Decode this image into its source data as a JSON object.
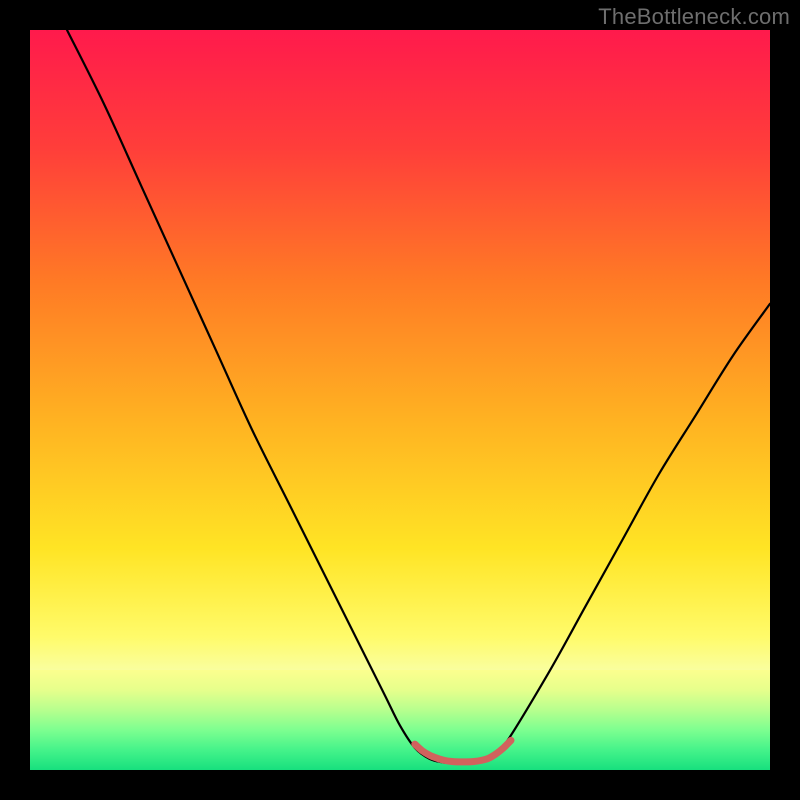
{
  "watermark": "TheBottleneck.com",
  "colors": {
    "frame": "#000000",
    "gradient_stops": [
      {
        "offset": 0.0,
        "color": "#ff1a4c"
      },
      {
        "offset": 0.16,
        "color": "#ff3e3a"
      },
      {
        "offset": 0.34,
        "color": "#ff7a25"
      },
      {
        "offset": 0.52,
        "color": "#ffb022"
      },
      {
        "offset": 0.7,
        "color": "#ffe424"
      },
      {
        "offset": 0.82,
        "color": "#fffb6a"
      },
      {
        "offset": 0.88,
        "color": "#f7ffb0"
      },
      {
        "offset": 0.92,
        "color": "#d0ff9e"
      },
      {
        "offset": 0.95,
        "color": "#8fff95"
      },
      {
        "offset": 0.975,
        "color": "#4cf58b"
      },
      {
        "offset": 1.0,
        "color": "#17e07e"
      }
    ],
    "bottom_strip_stops": [
      {
        "offset": 0.0,
        "color": "#fcff8e"
      },
      {
        "offset": 0.2,
        "color": "#e6ff8c"
      },
      {
        "offset": 0.4,
        "color": "#b7ff8e"
      },
      {
        "offset": 0.6,
        "color": "#7dff90"
      },
      {
        "offset": 0.8,
        "color": "#45f38a"
      },
      {
        "offset": 1.0,
        "color": "#17e07e"
      }
    ],
    "curve": "#000000",
    "highlight": "#d1625d"
  },
  "chart_data": {
    "type": "line",
    "title": "",
    "xlabel": "",
    "ylabel": "",
    "xlim": [
      0,
      100
    ],
    "ylim": [
      0,
      100
    ],
    "series": [
      {
        "name": "bottleneck-curve",
        "x": [
          5,
          10,
          15,
          20,
          25,
          30,
          35,
          40,
          45,
          48,
          50,
          52,
          54,
          56,
          58,
          60,
          62,
          64,
          70,
          75,
          80,
          85,
          90,
          95,
          100
        ],
        "y": [
          100,
          90,
          79,
          68,
          57,
          46,
          36,
          26,
          16,
          10,
          6,
          3,
          1.5,
          1,
          1,
          1.2,
          1.8,
          3.2,
          13,
          22,
          31,
          40,
          48,
          56,
          63
        ]
      },
      {
        "name": "optimal-range-highlight",
        "x": [
          52,
          53,
          54,
          55,
          56,
          57,
          58,
          59,
          60,
          61,
          62,
          63,
          64,
          65
        ],
        "y": [
          3.5,
          2.6,
          2.0,
          1.6,
          1.3,
          1.15,
          1.1,
          1.1,
          1.15,
          1.3,
          1.6,
          2.2,
          3.0,
          4.0
        ]
      }
    ]
  }
}
